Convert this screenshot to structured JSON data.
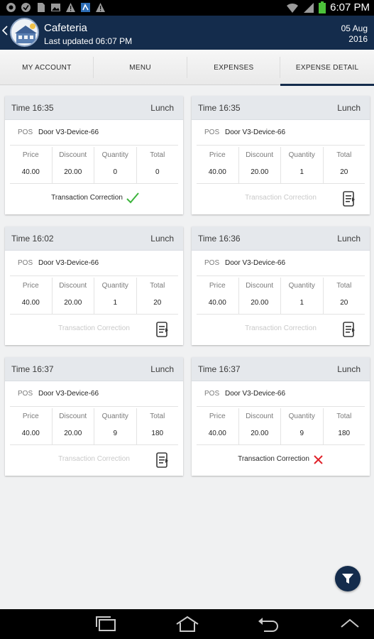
{
  "status_bar": {
    "time": "6:07 PM",
    "left_icons": [
      "notification-icon",
      "notification-icon",
      "sd-card-icon",
      "image-icon",
      "warning-icon",
      "app-icon",
      "warning-icon"
    ],
    "right_icons": [
      "wifi-icon",
      "signal-icon",
      "battery-icon"
    ]
  },
  "header": {
    "title": "Cafeteria",
    "subtitle": "Last updated 06:07 PM",
    "date": "05 Aug",
    "year": "2016"
  },
  "tabs": [
    {
      "label": "MY ACCOUNT",
      "active": false
    },
    {
      "label": "MENU",
      "active": false
    },
    {
      "label": "EXPENSES",
      "active": false
    },
    {
      "label": "EXPENSE DETAIL",
      "active": true
    }
  ],
  "columns": {
    "price": "Price",
    "discount": "Discount",
    "quantity": "Quantity",
    "total": "Total"
  },
  "pos_label": "POS",
  "cards": [
    {
      "time": "Time 16:35",
      "meal": "Lunch",
      "pos": "Door V3-Device-66",
      "price": "40.00",
      "discount": "20.00",
      "quantity": "0",
      "total": "0",
      "correction": "Transaction Correction",
      "correction_state": "approved"
    },
    {
      "time": "Time 16:35",
      "meal": "Lunch",
      "pos": "Door V3-Device-66",
      "price": "40.00",
      "discount": "20.00",
      "quantity": "1",
      "total": "20",
      "correction": "Transaction Correction",
      "correction_state": "available"
    },
    {
      "time": "Time 16:02",
      "meal": "Lunch",
      "pos": "Door V3-Device-66",
      "price": "40.00",
      "discount": "20.00",
      "quantity": "1",
      "total": "20",
      "correction": "Transaction Correction",
      "correction_state": "available"
    },
    {
      "time": "Time 16:36",
      "meal": "Lunch",
      "pos": "Door V3-Device-66",
      "price": "40.00",
      "discount": "20.00",
      "quantity": "1",
      "total": "20",
      "correction": "Transaction Correction",
      "correction_state": "available"
    },
    {
      "time": "Time 16:37",
      "meal": "Lunch",
      "pos": "Door V3-Device-66",
      "price": "40.00",
      "discount": "20.00",
      "quantity": "9",
      "total": "180",
      "correction": "Transaction Correction",
      "correction_state": "available"
    },
    {
      "time": "Time 16:37",
      "meal": "Lunch",
      "pos": "Door V3-Device-66",
      "price": "40.00",
      "discount": "20.00",
      "quantity": "9",
      "total": "180",
      "correction": "Transaction Correction",
      "correction_state": "rejected"
    }
  ],
  "fab_icon": "filter-icon",
  "nav_bar": [
    "recent-apps-icon",
    "home-icon",
    "back-icon",
    "chevron-up-icon"
  ],
  "colors": {
    "header_bg": "#142c4c",
    "approved": "#3cb43c",
    "rejected": "#e0232b",
    "dim_text": "#c9c9c9"
  }
}
